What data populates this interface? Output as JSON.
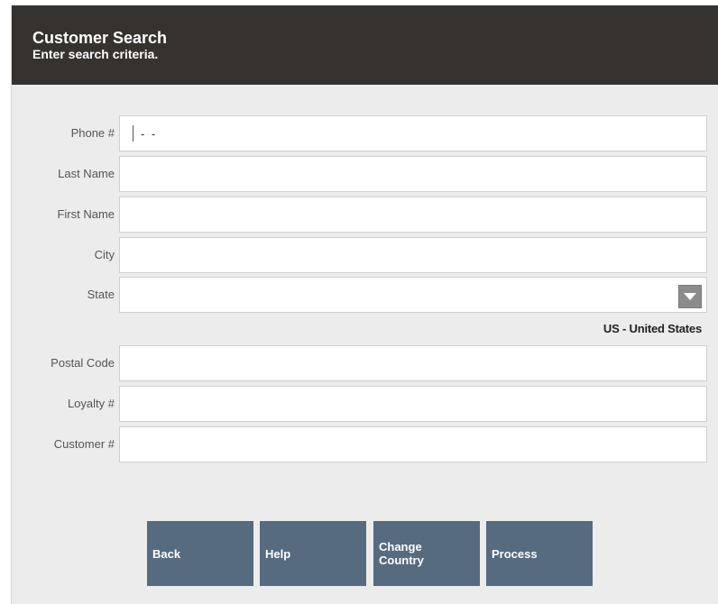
{
  "header": {
    "title": "Customer Search",
    "subtitle": "Enter search criteria."
  },
  "fields": {
    "phone": {
      "label": "Phone #",
      "mask": "- -"
    },
    "last_name": {
      "label": "Last Name",
      "value": ""
    },
    "first_name": {
      "label": "First Name",
      "value": ""
    },
    "city": {
      "label": "City",
      "value": ""
    },
    "state": {
      "label": "State",
      "value": ""
    },
    "country_text": "US - United States",
    "postal_code": {
      "label": "Postal Code",
      "value": ""
    },
    "loyalty": {
      "label": "Loyalty #",
      "value": ""
    },
    "customer": {
      "label": "Customer #",
      "value": ""
    }
  },
  "buttons": {
    "back": "Back",
    "help": "Help",
    "change_country": "Change\nCountry",
    "process": "Process"
  },
  "colors": {
    "header_bg": "#36332f",
    "button_bg": "#566a80",
    "dropdown_bg": "#8c8c8c"
  },
  "icons": {
    "state_dropdown": "chevron-down-icon"
  }
}
